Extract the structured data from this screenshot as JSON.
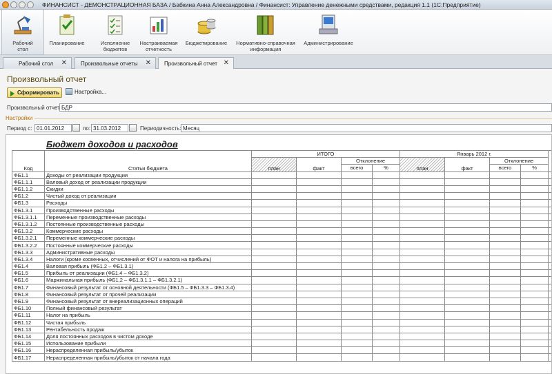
{
  "window": {
    "title": "ФИНАНСИСТ - ДЕМОНСТРАЦИОННАЯ БАЗА / Бабкина Анна Александровна / Финансист: Управление денежными средствами, редакция 1.1  (1С:Предприятие)"
  },
  "ribbon": [
    {
      "label": "Рабочий\nстол",
      "icon": "desk-lamp-icon"
    },
    {
      "label": "Планирование",
      "icon": "clipboard-check-icon"
    },
    {
      "label": "Исполнение\nбюджетов",
      "icon": "checklist-icon"
    },
    {
      "label": "Настраиваемая\nотчетность",
      "icon": "report-chart-icon"
    },
    {
      "label": "Бюджетирование",
      "icon": "coins-icon"
    },
    {
      "label": "Нормативно-справочная\nинформация",
      "icon": "binders-icon"
    },
    {
      "label": "Администрирование",
      "icon": "computer-icon"
    }
  ],
  "tabs": [
    {
      "label": "Рабочий стол"
    },
    {
      "label": "Произвольные отчеты"
    },
    {
      "label": "Произвольный отчет"
    }
  ],
  "form": {
    "title": "Произвольный отчет",
    "run_label": "Сформировать",
    "settings_label": "Настройка...",
    "report_label": "Произвольный отчет:",
    "report_value": "БДР",
    "section_label": "Настройки",
    "period_from_label": "Период с:",
    "period_from": "01.01.2012",
    "period_to_label": "по:",
    "period_to": "31.03.2012",
    "periodicity_label": "Периодичность:",
    "periodicity": "Месяц"
  },
  "report": {
    "title": "Бюджет доходов и расходов",
    "col_code": "Код",
    "col_items": "Статьи бюджета",
    "group1": "ИТОГО",
    "group2": "Январь 2012 г.",
    "plan": "план",
    "fact": "факт",
    "deviation": "Отклонение",
    "total": "всего",
    "percent": "%",
    "rows": [
      [
        "ФБ1.1",
        "Доходы от реализации продукции"
      ],
      [
        "ФБ1.1.1",
        "Валовый доход от реализации продукции"
      ],
      [
        "ФБ1.1.2",
        "Скидки"
      ],
      [
        "ФБ1.2",
        "Чистый доход от реализации"
      ],
      [
        "ФБ1.3",
        "Расходы"
      ],
      [
        "ФБ1.3.1",
        "Производственные расходы"
      ],
      [
        "ФБ1.3.1.1",
        "Переменные производственные расходы"
      ],
      [
        "ФБ1.3.1.2",
        "Постоянные производственные расходы"
      ],
      [
        "ФБ1.3.2",
        "Коммерческие расходы"
      ],
      [
        "ФБ1.3.2.1",
        "Переменные коммерческие расходы"
      ],
      [
        "ФБ1.3.2.2",
        "Постоянные коммерческие расходы"
      ],
      [
        "ФБ1.3.3",
        "Административные расходы"
      ],
      [
        "ФБ1.3.4",
        "Налоги (кроме косвенных, отчислений от ФОТ и налога на прибыль)"
      ],
      [
        "ФБ1.4",
        "Валовая прибыль (ФБ1.2 – ФБ1.3.1)"
      ],
      [
        "ФБ1.5",
        "Прибыль от реализации (ФБ1.4 – ФБ1.3.2)"
      ],
      [
        "ФБ1.6",
        "Маржинальная прибыль (ФБ1.2 – ФБ1.3.1.1 – ФБ1.3.2.1)"
      ],
      [
        "ФБ1.7",
        "Финансовый результат от основной деятельности (ФБ1.5 – ФБ1.3.3 – ФБ1.3.4)"
      ],
      [
        "ФБ1.8",
        "Финансовый результат от прочей реализации"
      ],
      [
        "ФБ1.9",
        "Финансовый результат от внереализационных операций"
      ],
      [
        "ФБ1.10",
        "Полный финансовый результат"
      ],
      [
        "ФБ1.11",
        "Налог на прибыль"
      ],
      [
        "ФБ1.12",
        "Чистая прибыль"
      ],
      [
        "ФБ1.13",
        "Рентабельность продаж"
      ],
      [
        "ФБ1.14",
        "Доля постоянных расходов в чистом доходе"
      ],
      [
        "ФБ1.15",
        "Использование прибыли"
      ],
      [
        "ФБ1.16",
        "Нераспределенная прибыль/убыток"
      ],
      [
        "ФБ1.17",
        "Нераспределенная прибыль/убыток от начала года"
      ]
    ]
  }
}
